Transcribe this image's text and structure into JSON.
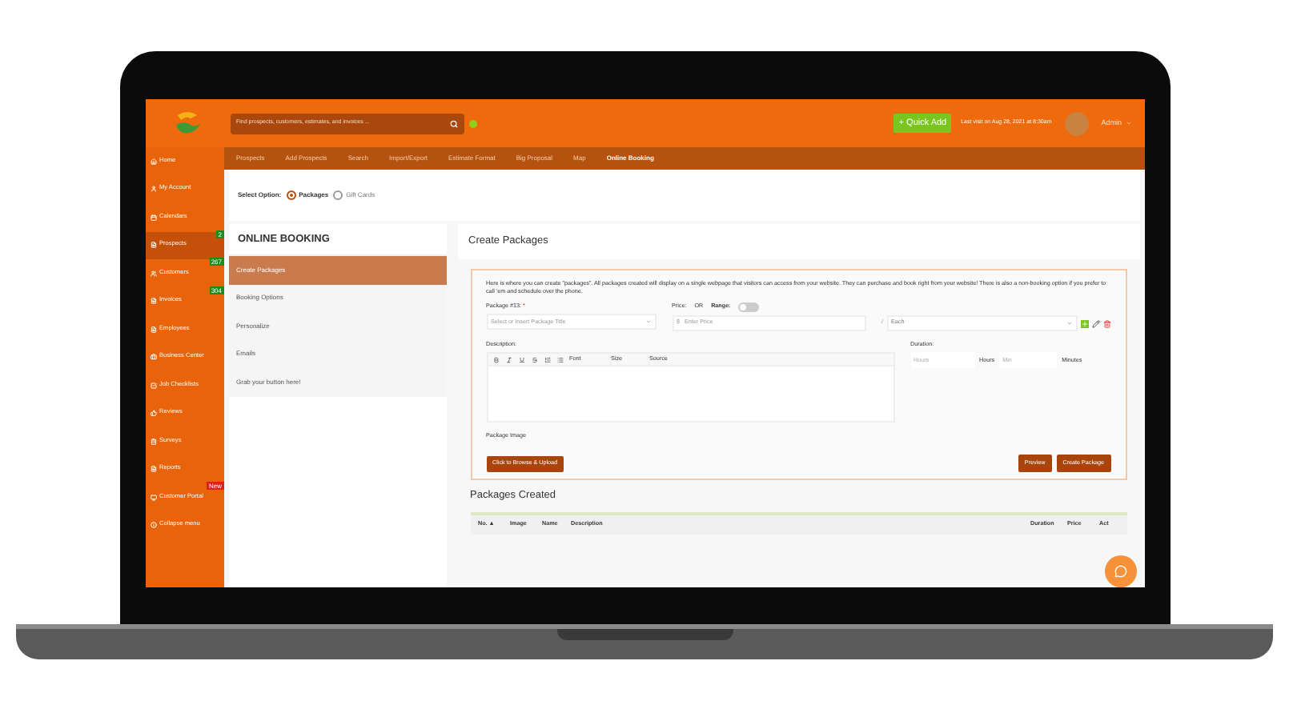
{
  "top_bar": {
    "search": {
      "placeholder": "Find prospects, customers, estimates, and invoices ..."
    },
    "quick_add": "+ Quick Add",
    "last_visit": "Last visit on Aug 28, 2021 at 8:30am",
    "user": "Admin"
  },
  "sidebar": {
    "items": [
      {
        "label": "Home",
        "selected": false
      },
      {
        "label": "My Account",
        "selected": false
      },
      {
        "label": "Calendars",
        "selected": false
      },
      {
        "label": "Prospects",
        "selected": true,
        "badge": "2",
        "color": "#1f8a1f"
      },
      {
        "label": "Customers",
        "selected": false,
        "badge": "267",
        "color": "#1f8a1f"
      },
      {
        "label": "Invoices",
        "selected": false,
        "badge": "304",
        "color": "#1f8a1f"
      },
      {
        "label": "Employees",
        "selected": false
      },
      {
        "label": "Business Center",
        "selected": false
      },
      {
        "label": "Job Checklists",
        "selected": false
      },
      {
        "label": "Reviews",
        "selected": false
      },
      {
        "label": "Surveys",
        "selected": false
      },
      {
        "label": "Reports",
        "selected": false
      },
      {
        "label": "Customer Portal",
        "selected": false,
        "badge": "New",
        "color": "#e01e1e"
      },
      {
        "label": "Collapse menu",
        "selected": false
      }
    ]
  },
  "nav": {
    "tabs": [
      {
        "label": "Prospects",
        "selected": false
      },
      {
        "label": "Add Prospects",
        "selected": false
      },
      {
        "label": "Search",
        "selected": false
      },
      {
        "label": "Import/Export",
        "selected": false
      },
      {
        "label": "Estimate Format",
        "selected": false
      },
      {
        "label": "Big Proposal",
        "selected": false
      },
      {
        "label": "Map",
        "selected": false
      },
      {
        "label": "Online Booking",
        "selected": true
      }
    ]
  },
  "select_option": {
    "label": "Select Option:",
    "options": [
      {
        "label": "Packages",
        "selected": true
      },
      {
        "label": "Gift Cards",
        "selected": false
      }
    ]
  },
  "left_panel": {
    "title": "ONLINE BOOKING",
    "items": [
      {
        "label": "Create Packages",
        "selected": true
      },
      {
        "label": "Booking Options",
        "selected": false
      },
      {
        "label": "Personalize",
        "selected": false
      },
      {
        "label": "Emails",
        "selected": false
      },
      {
        "label": "Grab your button here!",
        "selected": false
      }
    ]
  },
  "create_packages": {
    "title": "Create Packages",
    "intro": "Here is where you can create \"packages\". All packages created will display on a single webpage that visitors can access from your website. They can purchase and book right from your website! There is also a non-booking option if you prefer to call 'em and schedule over the phone.",
    "package_label": "Package #13:",
    "required_mark": "*",
    "package_placeholder": "Select or Insert Package Title",
    "price_label": "Price:",
    "or_label": "OR",
    "range_label": "Range:",
    "range_on": false,
    "currency": "$",
    "price_placeholder": "Enter Price",
    "per": "/",
    "unit_value": "Each",
    "description_label": "Description:",
    "toolbar": {
      "font": "Font",
      "size": "Size",
      "source": "Source"
    },
    "duration_label": "Duration:",
    "hours_placeholder": "Hours",
    "hours_label": "Hours",
    "min_placeholder": "Min",
    "minutes_label": "Minutes",
    "image_label": "Package Image",
    "upload_button": "Click to Browse & Upload",
    "preview_button": "Preview",
    "create_button": "Create Package"
  },
  "packages_created": {
    "title": "Packages Created",
    "columns": [
      "No. ▲",
      "Image",
      "Name",
      "Description",
      "Duration",
      "Price",
      "Act"
    ]
  }
}
